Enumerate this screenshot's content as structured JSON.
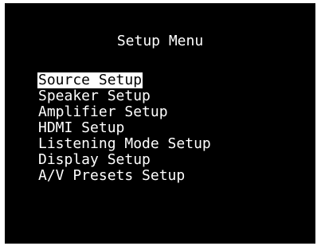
{
  "menu": {
    "title": "Setup Menu",
    "items": [
      {
        "label": "Source Setup",
        "selected": true
      },
      {
        "label": "Speaker Setup",
        "selected": false
      },
      {
        "label": "Amplifier Setup",
        "selected": false
      },
      {
        "label": "HDMI Setup",
        "selected": false
      },
      {
        "label": "Listening Mode Setup",
        "selected": false
      },
      {
        "label": "Display Setup",
        "selected": false
      },
      {
        "label": "A/V Presets Setup",
        "selected": false
      }
    ]
  },
  "colors": {
    "background": "#000000",
    "text": "#ffffff",
    "highlight": "#ffffff",
    "highlight_text": "#000000"
  }
}
